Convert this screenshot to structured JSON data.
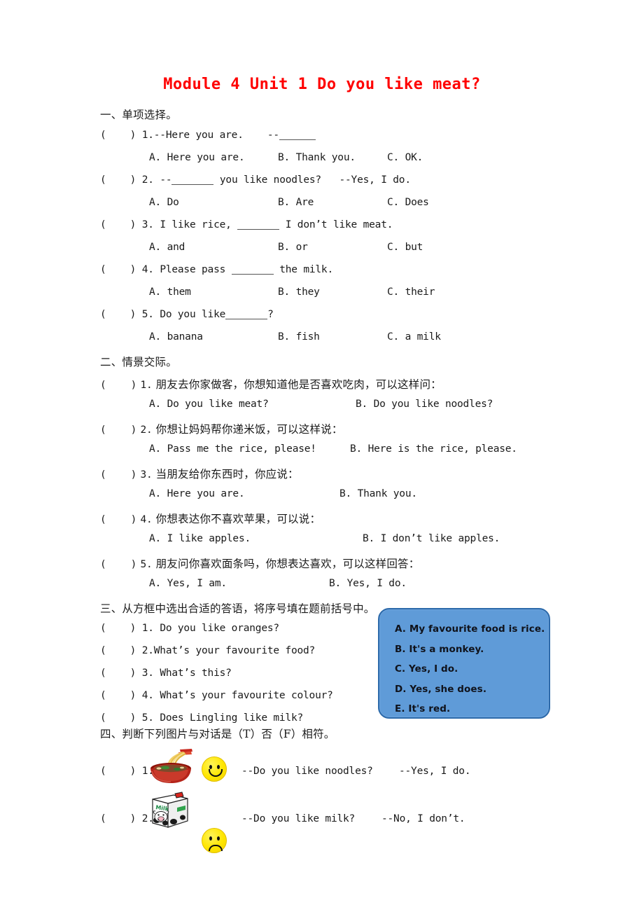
{
  "document": {
    "title": "Module 4 Unit 1 Do you like meat?",
    "title_color": "#ff0000"
  },
  "sections": [
    {
      "heading": "一、单项选择。",
      "questions": [
        {
          "bracket": "(    )",
          "number": "1.",
          "stem": "--Here you are.    --",
          "options": [
            "A. Here you are.",
            "B. Thank you.",
            "C. OK."
          ]
        },
        {
          "bracket": "(    )",
          "number": "2.",
          "stem_pre": "--",
          "stem_post": " you like noodles?   --Yes, I do.",
          "options": [
            "A. Do",
            "B. Are",
            "C. Does"
          ]
        },
        {
          "bracket": "(    )",
          "number": "3.",
          "stem_pre": "I like rice, ",
          "stem_post": " I don’t like meat.",
          "options": [
            "A. and",
            "B. or",
            "C. but"
          ]
        },
        {
          "bracket": "(    )",
          "number": "4.",
          "stem_pre": "Please pass ",
          "stem_post": " the milk.",
          "options": [
            "A. them",
            "B. they",
            "C. their"
          ]
        },
        {
          "bracket": "(    )",
          "number": "5.",
          "stem_pre": "Do you like",
          "stem_post": "?",
          "options": [
            "A. banana",
            "B. fish",
            "C. a milk"
          ]
        }
      ]
    },
    {
      "heading": "二、情景交际。",
      "questions": [
        {
          "bracket": "(    )",
          "number": "1.",
          "stem": "朋友去你家做客，你想知道他是否喜欢吃肉，可以这样问：",
          "options": [
            "A. Do you like meat?",
            "B. Do you like noodles?"
          ]
        },
        {
          "bracket": "(    )",
          "number": "2.",
          "stem": "你想让妈妈帮你递米饭，可以这样说：",
          "options": [
            "A. Pass me the rice, please!",
            "B. Here is the rice, please."
          ]
        },
        {
          "bracket": "(    )",
          "number": "3.",
          "stem": "当朋友给你东西时，你应说：",
          "options": [
            "A. Here you are.",
            "B. Thank you."
          ]
        },
        {
          "bracket": "(    )",
          "number": "4.",
          "stem": "你想表达你不喜欢苹果，可以说：",
          "options": [
            "A. I like apples.",
            "B. I don’t like apples."
          ]
        },
        {
          "bracket": "(    )",
          "number": "5.",
          "stem": "朋友问你喜欢面条吗，你想表达喜欢，可以这样回答：",
          "options": [
            "A. Yes, I am.",
            "B. Yes, I do."
          ]
        }
      ]
    },
    {
      "heading": "三、从方框中选出合适的答语，将序号填在题前括号中。",
      "questions": [
        {
          "bracket": "(    )",
          "number": "1.",
          "stem": "Do you like oranges?"
        },
        {
          "bracket": "(    )",
          "number": "2.",
          "stem": "What’s your favourite food?"
        },
        {
          "bracket": "(    )",
          "number": "3.",
          "stem": "What’s this?"
        },
        {
          "bracket": "(    )",
          "number": "4.",
          "stem": "What’s your favourite colour?"
        },
        {
          "bracket": "(    )",
          "number": "5.",
          "stem": "Does Lingling like milk?"
        }
      ],
      "answer_box": {
        "background_color": "#5f9bd8",
        "border_color": "#2d6aaa",
        "lines": [
          "A. My favourite food is rice.",
          "B. It's a monkey.",
          "C. Yes, I do.",
          "D. Yes, she does.",
          "E. It's red."
        ]
      }
    },
    {
      "heading": "四、判断下列图片与对话是（T）否（F）相符。",
      "questions": [
        {
          "bracket": "(    )",
          "number": "1.",
          "picture": "noodle-bowl-image",
          "face": "smiley-happy-icon",
          "dialogue_q": "--Do you like noodles?",
          "dialogue_a": "--Yes, I do."
        },
        {
          "bracket": "(    )",
          "number": "2.",
          "picture": "milk-carton-image",
          "face": "smiley-sad-icon",
          "dialogue_q": "--Do you like milk?",
          "dialogue_a": "--No, I don’t."
        }
      ]
    }
  ],
  "clipart": {
    "milk_label": "Milk"
  }
}
